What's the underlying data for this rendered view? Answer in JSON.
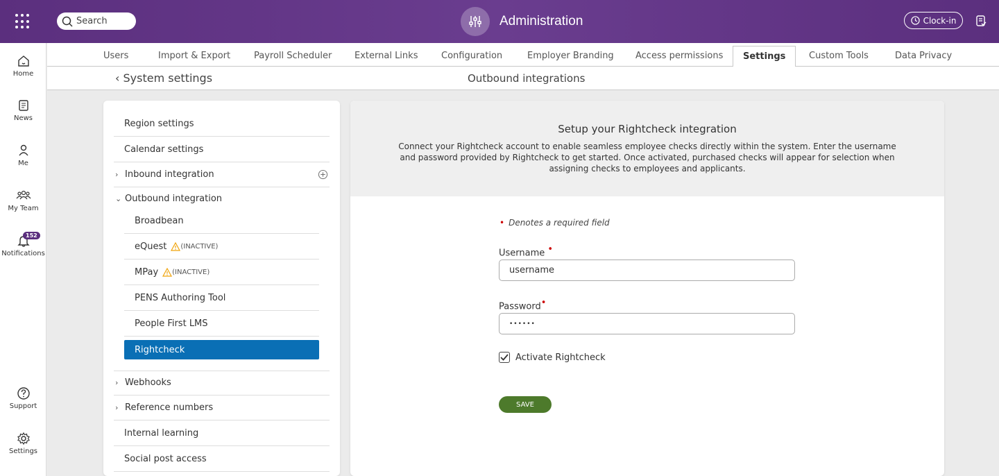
{
  "header": {
    "search_placeholder": "Search",
    "app_title": "Administration",
    "clockin_label": "Clock-in"
  },
  "leftnav": {
    "home": "Home",
    "news": "News",
    "me": "Me",
    "my_team": "My Team",
    "notifications": "Notifications",
    "notifications_count": "152",
    "support": "Support",
    "settings": "Settings"
  },
  "tabs": [
    "Users",
    "Import & Export",
    "Payroll Scheduler",
    "External Links",
    "Configuration",
    "Employer Branding",
    "Access permissions",
    "Settings",
    "Custom Tools",
    "Data Privacy"
  ],
  "active_tab": "Settings",
  "subbar": {
    "back_label": "System settings",
    "title": "Outbound integrations"
  },
  "settings_list": {
    "region": "Region settings",
    "calendar": "Calendar settings",
    "inbound": "Inbound integration",
    "outbound": "Outbound integration",
    "sub": {
      "broadbean": "Broadbean",
      "equest": "eQuest",
      "mpay": "MPay",
      "pens": "PENS Authoring Tool",
      "people_first": "People First LMS",
      "rightcheck": "Rightcheck"
    },
    "inactive_label": "(INACTIVE)",
    "webhooks": "Webhooks",
    "reference_numbers": "Reference numbers",
    "internal_learning": "Internal learning",
    "social_post_access": "Social post access"
  },
  "form": {
    "heading": "Setup your Rightcheck integration",
    "description": "Connect your Rightcheck account to enable seamless employee checks directly within the system. Enter the username and password provided by Rightcheck to get started. Once activated, purchased checks will appear for selection when assigning checks to employees and applicants.",
    "required_note": "Denotes a required field",
    "username_label": "Username",
    "username_value": "username",
    "password_label": "Password",
    "password_value": "••••••",
    "activate_label": "Activate Rightcheck",
    "activate_checked": true,
    "save_label": "SAVE"
  },
  "colors": {
    "brand_purple": "#5b2f7e",
    "selected_blue": "#0a6fb5",
    "save_green": "#4d7a2b",
    "required_red": "#cc0000",
    "warning_orange": "#f0a30a"
  }
}
